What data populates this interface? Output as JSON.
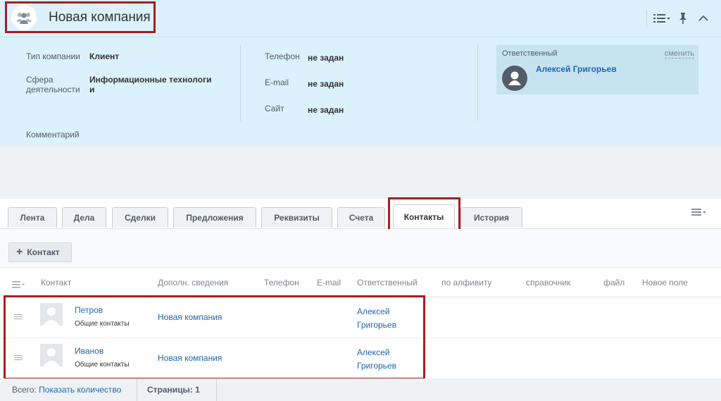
{
  "header": {
    "title": "Новая компания",
    "icons": {
      "entity": "company-people-icon",
      "view": "list-view-icon",
      "pin": "pin-icon",
      "collapse": "chevron-up-icon"
    }
  },
  "details": {
    "company_type_label": "Тип компании",
    "company_type_value": "Клиент",
    "industry_label_1": "Сфера",
    "industry_label_2": "деятельности",
    "industry_value_1": "Информационные технологи",
    "industry_value_2": "и",
    "phone_label": "Телефон",
    "phone_value": "не задан",
    "email_label": "E-mail",
    "email_value": "не задан",
    "site_label": "Сайт",
    "site_value": "не задан",
    "comment_label": "Комментарий"
  },
  "responsible": {
    "label": "Ответственный",
    "change": "сменить",
    "name": "Алексей Григорьев"
  },
  "tabs": [
    {
      "label": "Лента"
    },
    {
      "label": "Дела"
    },
    {
      "label": "Сделки"
    },
    {
      "label": "Предложения"
    },
    {
      "label": "Реквизиты"
    },
    {
      "label": "Счета"
    },
    {
      "label": "Контакты",
      "active": true
    },
    {
      "label": "История"
    }
  ],
  "toolbar": {
    "add_label": "Контакт"
  },
  "table": {
    "columns": [
      "Контакт",
      "Дополн. сведения",
      "Телефон",
      "E-mail",
      "Ответственный",
      "по алфивиту",
      "справочник",
      "файл",
      "Новое поле"
    ],
    "rows": [
      {
        "name": "Петров",
        "group": "Общие контакты",
        "company": "Новая компания",
        "resp_1": "Алексей",
        "resp_2": "Григорьев"
      },
      {
        "name": "Иванов",
        "group": "Общие контакты",
        "company": "Новая компания",
        "resp_1": "Алексей",
        "resp_2": "Григорьев"
      }
    ]
  },
  "footer": {
    "total_label": "Всего:",
    "show_count": "Показать количество",
    "pages": "Страницы: 1"
  },
  "colors": {
    "header_bg": "#dbf1fb",
    "link": "#2067b0",
    "highlight": "#a31f24"
  }
}
